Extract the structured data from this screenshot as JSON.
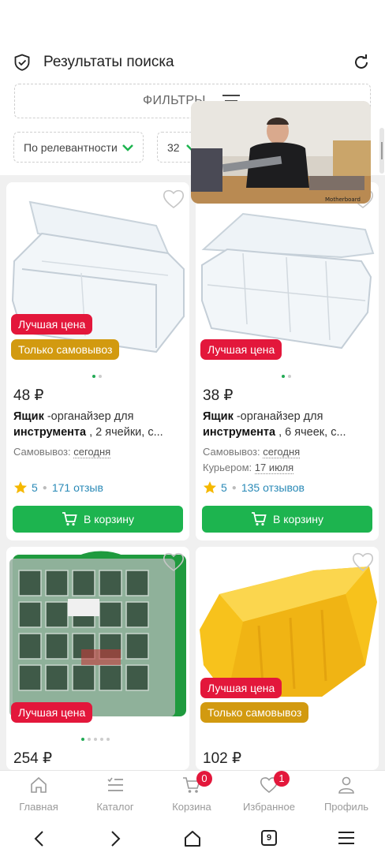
{
  "header": {
    "title": "Результаты поиска"
  },
  "filters": {
    "label": "ФИЛЬТРЫ"
  },
  "sort": {
    "label": "По релевантности"
  },
  "page_size": {
    "value": "32"
  },
  "products": [
    {
      "badges": [
        "Лучшая цена",
        "Только самовывоз"
      ],
      "price": "48 ₽",
      "name_bold1": "Ящик",
      "name_text1": " -органайзер для ",
      "name_bold2": "инструмента",
      "name_text2": " , 2 ячейки, с...",
      "pickup_label": "Самовывоз:",
      "pickup_date": "сегодня",
      "rating": "5",
      "reviews": "171 отзыв",
      "button": "В корзину",
      "dots": 2,
      "active_dot": 0
    },
    {
      "badges": [
        "Лучшая цена"
      ],
      "price": "38 ₽",
      "name_bold1": "Ящик",
      "name_text1": " -органайзер для ",
      "name_bold2": "инструмента",
      "name_text2": " , 6 ячеек, с...",
      "pickup_label": "Самовывоз:",
      "pickup_date": "сегодня",
      "courier_label": "Курьером:",
      "courier_date": "17 июля",
      "rating": "5",
      "reviews": "135 отзывов",
      "button": "В корзину",
      "dots": 2,
      "active_dot": 0
    },
    {
      "badges": [
        "Лучшая цена"
      ],
      "price": "254 ₽",
      "dots": 5,
      "active_dot": 0
    },
    {
      "badges": [
        "Лучшая цена",
        "Только самовывоз"
      ],
      "price": "102 ₽"
    }
  ],
  "video": {
    "caption": "Motherboard"
  },
  "tabbar": {
    "items": [
      {
        "label": "Главная",
        "icon": "home-icon"
      },
      {
        "label": "Каталог",
        "icon": "catalog-icon"
      },
      {
        "label": "Корзина",
        "icon": "cart-icon",
        "badge": "0"
      },
      {
        "label": "Избранное",
        "icon": "heart-icon",
        "badge": "1"
      },
      {
        "label": "Профиль",
        "icon": "profile-icon"
      }
    ]
  },
  "sysnav": {
    "tabs_count": "9"
  },
  "colors": {
    "accent": "#1db44f",
    "badge_red": "#e3173b",
    "badge_gold": "#d29a10",
    "link": "#2a8ab7"
  }
}
